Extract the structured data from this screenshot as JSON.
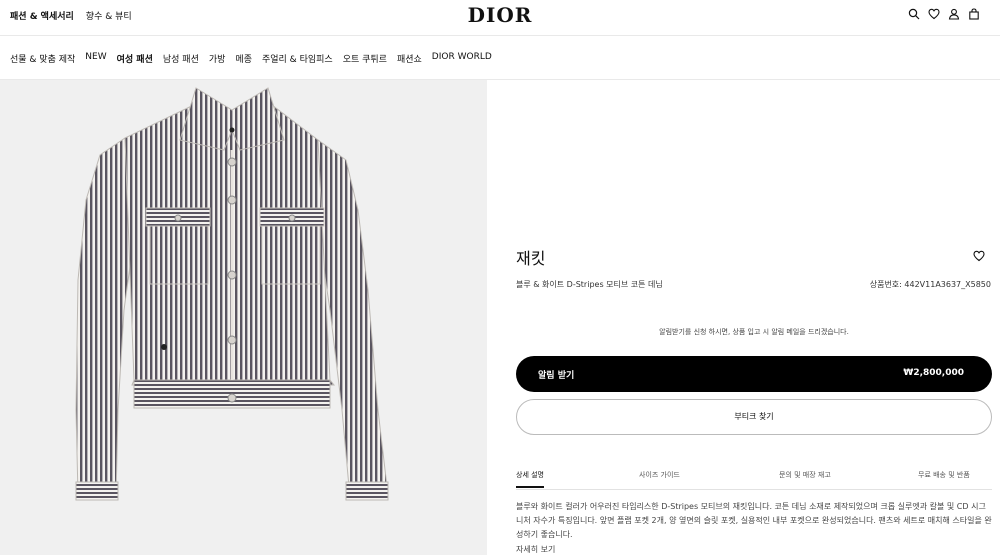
{
  "header": {
    "left_links": [
      "패션 & 액세서리",
      "향수 & 뷰티"
    ],
    "logo": "DIOR",
    "icons": [
      "search-icon",
      "heart-icon",
      "user-icon",
      "bag-icon"
    ]
  },
  "nav": {
    "items": [
      "선물 & 맞춤 제작",
      "NEW",
      "여성 패션",
      "남성 패션",
      "가방",
      "메종",
      "주얼리 & 타임피스",
      "오트 쿠튀르",
      "패션쇼",
      "DIOR WORLD"
    ]
  },
  "product": {
    "title": "재킷",
    "subtitle": "블루 & 화이트 D-Stripes 모티브 코튼 데님",
    "code": "상품번호: 442V11A3637_X5850",
    "notice": "알림받기를 신청 하시면, 상품 입고 시 알림 메일을 드리겠습니다.",
    "primary_label": "알림 받기",
    "price": "₩2,800,000",
    "secondary_label": "부티크 찾기"
  },
  "tabs": [
    "상세 설명",
    "사이즈 가이드",
    "문의 및 매장 재고",
    "무료 배송 및 반품"
  ],
  "description": {
    "text": "블루와 화이트 컬러가 어우러진 타임리스한 D-Stripes 모티브의 재킷입니다. 코튼 데님 소재로 제작되었으며 크롭 실루엣과 칼볼 및 CD 시그니처 자수가 특징입니다. 앞면 플랩 포켓 2개, 양 옆면의 슬릿 포켓, 실용적인 내부 포켓으로 완성되었습니다. 팬츠와 세트로 매치해 스타일을 완성하기 좋습니다.",
    "more": "자세히 보기"
  },
  "colors": {
    "stripe": "#5a5560",
    "stripe_light": "#f4f2ef",
    "accent": "#000000"
  }
}
